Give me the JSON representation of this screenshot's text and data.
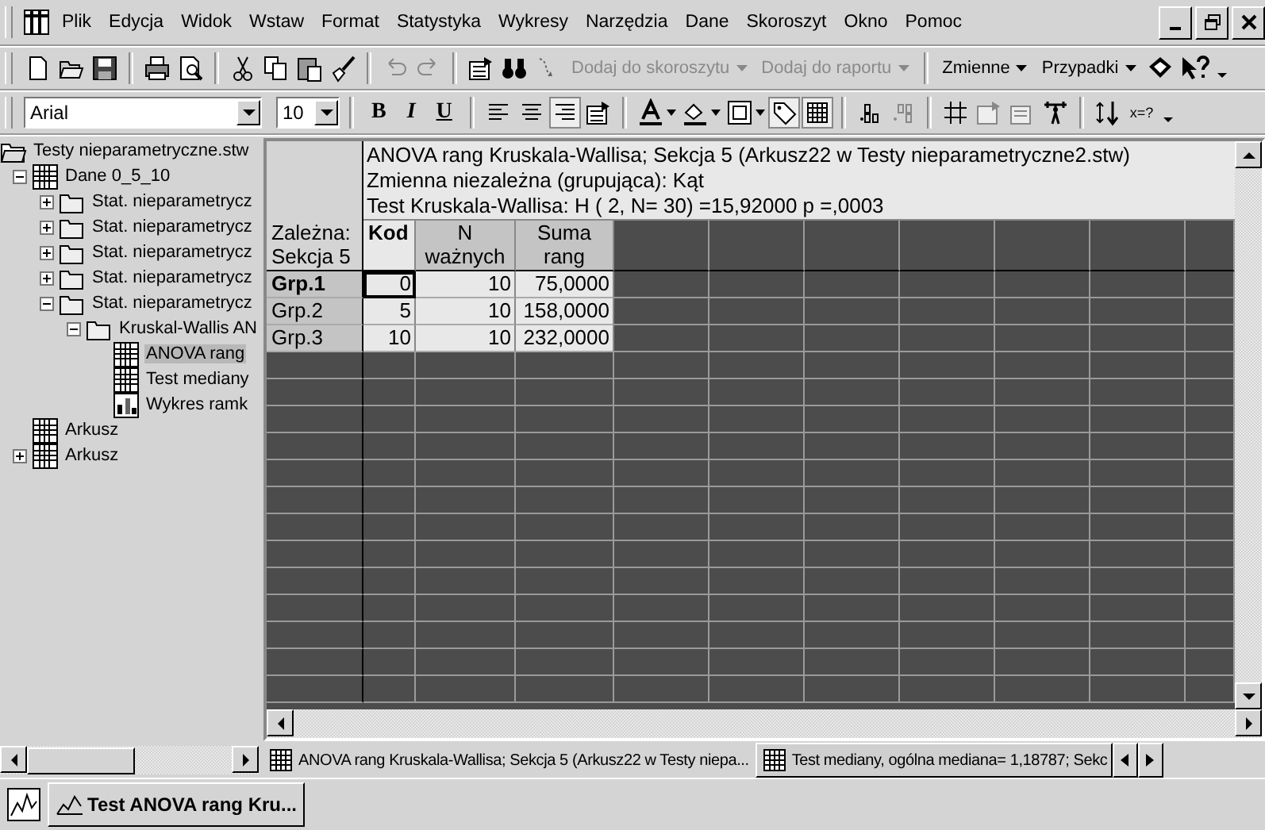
{
  "menu": [
    "Plik",
    "Edycja",
    "Widok",
    "Wstaw",
    "Format",
    "Statystyka",
    "Wykresy",
    "Narzędzia",
    "Dane",
    "Skoroszyt",
    "Okno",
    "Pomoc"
  ],
  "toolbar": {
    "buttons": [
      {
        "label": "Dodaj do skoroszytu",
        "disabled": true
      },
      {
        "label": "Dodaj do raportu",
        "disabled": true
      },
      {
        "label": "Zmienne",
        "disabled": false
      },
      {
        "label": "Przypadki",
        "disabled": false
      }
    ]
  },
  "format_bar": {
    "font": "Arial",
    "size": "10",
    "styles": [
      "B",
      "I",
      "U"
    ],
    "formula": "x=?"
  },
  "tree": [
    {
      "label": "Testy nieparametryczne.stw",
      "kind": "workbook",
      "selected": false,
      "children": [
        {
          "label": "Dane 0_5_10",
          "kind": "sheet",
          "expanded": true,
          "selected": false,
          "children": [
            {
              "label": "Stat. nieparametrycz",
              "kind": "folder",
              "expanded": false,
              "selected": false
            },
            {
              "label": "Stat. nieparametrycz",
              "kind": "folder",
              "expanded": false,
              "selected": false
            },
            {
              "label": "Stat. nieparametrycz",
              "kind": "folder",
              "expanded": false,
              "selected": false
            },
            {
              "label": "Stat. nieparametrycz",
              "kind": "folder",
              "expanded": false,
              "selected": false
            },
            {
              "label": "Stat. nieparametrycz",
              "kind": "folder",
              "expanded": true,
              "selected": false,
              "children": [
                {
                  "label": "Kruskal-Wallis AN",
                  "kind": "folder",
                  "expanded": true,
                  "selected": false,
                  "children": [
                    {
                      "label": "ANOVA rang",
                      "kind": "sheet",
                      "selected": true
                    },
                    {
                      "label": "Test mediany",
                      "kind": "sheet",
                      "selected": false
                    },
                    {
                      "label": "Wykres ramk",
                      "kind": "graph",
                      "selected": false
                    }
                  ]
                }
              ]
            }
          ]
        },
        {
          "label": "Arkusz",
          "kind": "sheet",
          "selected": false
        },
        {
          "label": "Arkusz",
          "kind": "sheet",
          "expanded": false,
          "selected": false
        }
      ]
    }
  ],
  "sheet": {
    "title_lines": [
      "ANOVA rang Kruskala-Wallisa; Sekcja 5 (Arkusz22 w Testy nieparametryczne2.stw)",
      "Zmienna niezależna (grupująca): Kąt",
      "Test Kruskala-Wallisa: H ( 2, N= 30) =15,92000 p =,0003"
    ],
    "corner_lines": [
      "Zależna:",
      "Sekcja 5"
    ],
    "columns": [
      {
        "lines": [
          "Kod"
        ],
        "kind": "key"
      },
      {
        "lines": [
          "N",
          "ważnych"
        ],
        "kind": "value"
      },
      {
        "lines": [
          "Suma",
          "rang"
        ],
        "kind": "value"
      }
    ],
    "rows": [
      {
        "label": "Grp.1",
        "selected": true,
        "cells": [
          "0",
          "10",
          "75,0000"
        ]
      },
      {
        "label": "Grp.2",
        "selected": false,
        "cells": [
          "5",
          "10",
          "158,0000"
        ]
      },
      {
        "label": "Grp.3",
        "selected": false,
        "cells": [
          "10",
          "10",
          "232,0000"
        ]
      }
    ]
  },
  "tabs": [
    {
      "label": "ANOVA rang Kruskala-Wallisa; Sekcja 5 (Arkusz22 w Testy niepa...",
      "selected": true
    },
    {
      "label": "Test mediany, ogólna mediana= 1,18787; Sekc",
      "selected": false
    }
  ],
  "taskbar": {
    "item": "Test ANOVA rang Kru..."
  }
}
